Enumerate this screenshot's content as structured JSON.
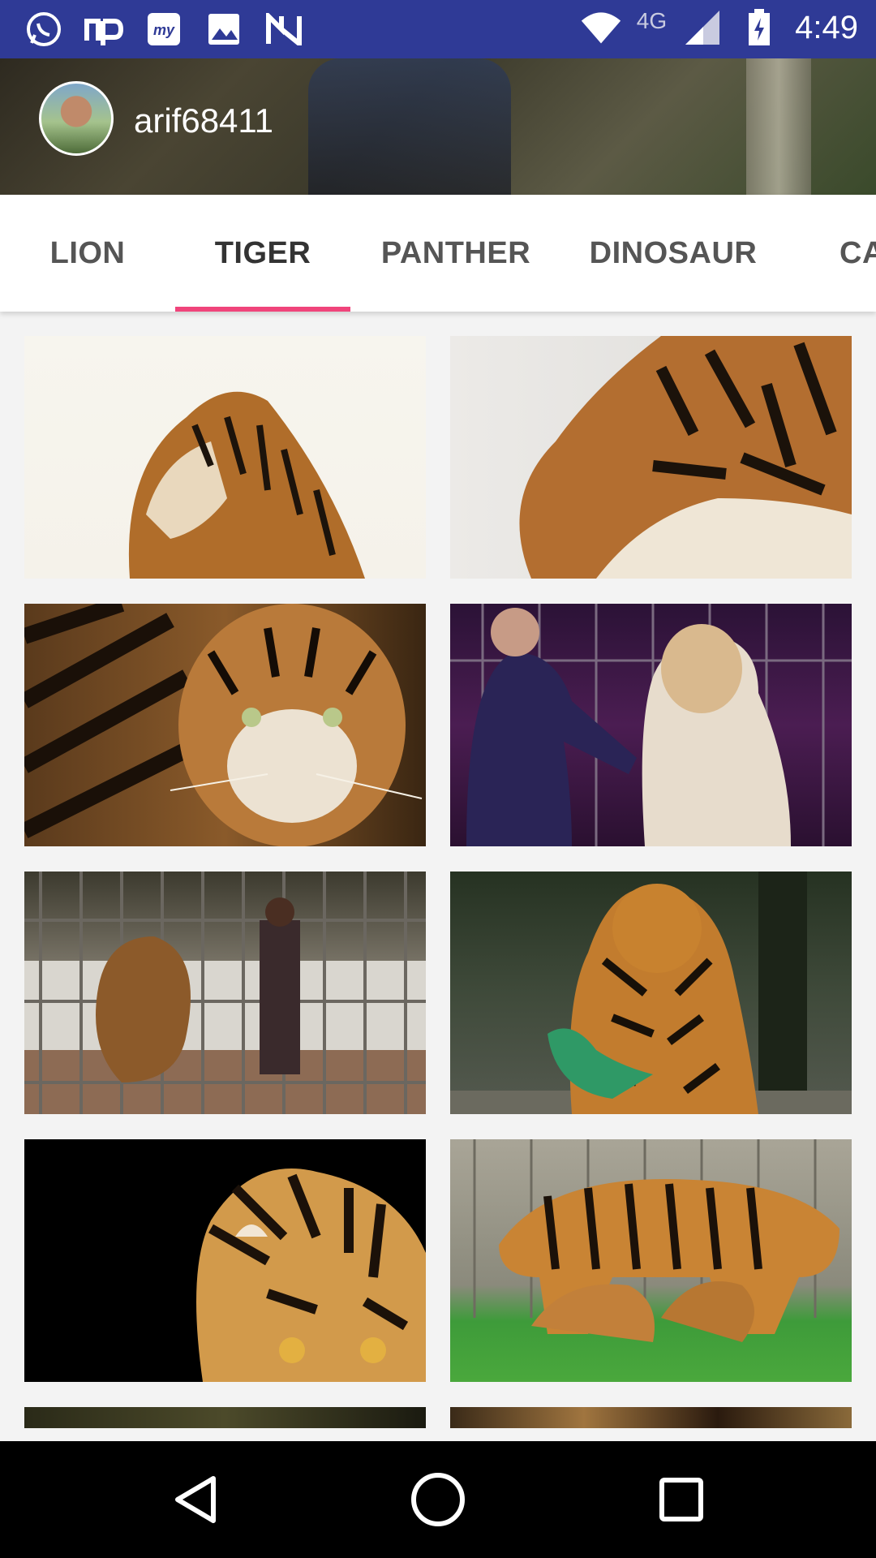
{
  "status_bar": {
    "time": "4:49",
    "network": "4G",
    "left_icons": [
      "whatsapp-icon",
      "np-icon",
      "my-icon",
      "gallery-icon",
      "n-icon"
    ],
    "right_icons": [
      "wifi-icon",
      "signal-icon",
      "battery-charging-icon"
    ]
  },
  "header": {
    "username": "arif68411"
  },
  "tabs": [
    {
      "label": "LION",
      "active": false
    },
    {
      "label": "TIGER",
      "active": true
    },
    {
      "label": "PANTHER",
      "active": false
    },
    {
      "label": "DINOSAUR",
      "active": false
    },
    {
      "label": "CA",
      "active": false
    }
  ],
  "accent_color": "#f0447b",
  "status_bar_color": "#2f3a96",
  "grid": {
    "images": [
      {
        "name": "tiger-image-profile-left"
      },
      {
        "name": "tiger-image-closeup-face"
      },
      {
        "name": "tiger-image-staring"
      },
      {
        "name": "tiger-image-circus"
      },
      {
        "name": "tiger-image-cage"
      },
      {
        "name": "tiger-image-standing-forest"
      },
      {
        "name": "tiger-image-crouching-dark"
      },
      {
        "name": "tiger-image-with-cubs"
      },
      {
        "name": "tiger-image-partial-1"
      },
      {
        "name": "tiger-image-partial-2"
      }
    ]
  },
  "nav_bar": {
    "buttons": [
      "back-icon",
      "home-icon",
      "recents-icon"
    ]
  }
}
